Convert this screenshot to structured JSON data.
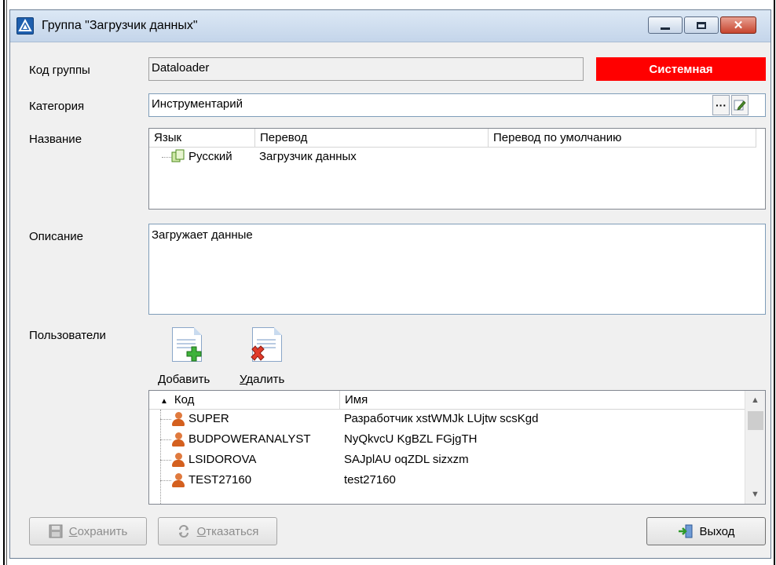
{
  "window": {
    "title": "Группа \"Загрузчик данных\"",
    "title_icon": "app-logo-icon"
  },
  "form": {
    "group_code_label": "Код группы",
    "group_code_value": "Dataloader",
    "system_badge": "Системная",
    "category_label": "Категория",
    "category_value": "Инструментарий",
    "category_picker_label": "···",
    "name_label": "Название",
    "description_label": "Описание",
    "description_value": "Загружает данные",
    "users_label": "Пользователи"
  },
  "name_grid": {
    "columns": [
      "Язык",
      "Перевод",
      "Перевод по умолчанию"
    ],
    "rows": [
      {
        "language": "Русский",
        "translation": "Загрузчик данных",
        "default": ""
      }
    ]
  },
  "users_toolbar": {
    "add_label_accel": "Д",
    "add_label_rest": "обавить",
    "delete_label_accel": "У",
    "delete_label_rest": "далить"
  },
  "users_grid": {
    "sort_indicator": "▲",
    "columns": [
      "Код",
      "Имя"
    ],
    "rows": [
      {
        "code": "SUPER",
        "name": "Разработчик xstWMJk LUjtw scsKgd"
      },
      {
        "code": "BUDPOWERANALYST",
        "name": "NyQkvcU KgBZL FGjgTH"
      },
      {
        "code": "LSIDOROVA",
        "name": "SAJplAU oqZDL sizxzm"
      },
      {
        "code": "TEST27160",
        "name": "test27160"
      }
    ]
  },
  "buttons": {
    "save_accel": "С",
    "save_rest": "охранить",
    "cancel_accel": "О",
    "cancel_rest": "тказаться",
    "exit": "Выход"
  },
  "colors": {
    "system_badge_bg": "#ff0000",
    "window_bg": "#f0f0f0"
  }
}
